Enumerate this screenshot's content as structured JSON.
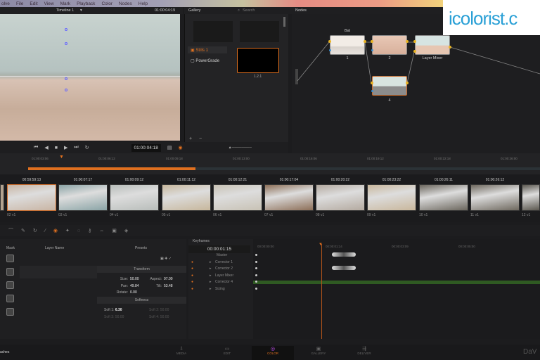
{
  "menu": [
    "olve",
    "File",
    "Edit",
    "View",
    "Mark",
    "Playback",
    "Color",
    "Nodes",
    "Help"
  ],
  "viewer": {
    "timeline_name": "Timeline 1",
    "timecode": "01:00:04:19",
    "transport_timecode": "01:00:04:18"
  },
  "gallery": {
    "title": "Gallery",
    "search_placeholder": "Search",
    "albums": [
      "Stills 1",
      "PowerGrade"
    ],
    "still_label": "1.2.1"
  },
  "nodes": {
    "title": "Nodes",
    "items": [
      {
        "label": "1",
        "top": "Bal"
      },
      {
        "label": "2"
      },
      {
        "label": "Layer Mixer"
      },
      {
        "label": "4"
      }
    ]
  },
  "logo": "icolorist.c",
  "ruler": [
    "01:00:03:06",
    "01:00:06:12",
    "01:00:09:18",
    "01:00:13:00",
    "01:00:16:06",
    "01:00:19:12",
    "01:00:22:18",
    "01:00:26:00"
  ],
  "clips": [
    {
      "tc": "00:59:59:13",
      "label": "02  v1",
      "color": "#c9b5a4"
    },
    {
      "tc": "01:00:07:17",
      "label": "03  v1",
      "color": "#8aa4a6"
    },
    {
      "tc": "01:00:09:12",
      "label": "04  v1",
      "color": "#b8bdba"
    },
    {
      "tc": "01:00:11:12",
      "label": "05  v1",
      "color": "#c7b79c"
    },
    {
      "tc": "01:00:12:21",
      "label": "06  v1",
      "color": "#c8c2b5"
    },
    {
      "tc": "01:00:17:04",
      "label": "07  v1",
      "color": "#8d6f58"
    },
    {
      "tc": "01:00:20:22",
      "label": "08  v1",
      "color": "#b4aaa0"
    },
    {
      "tc": "01:00:23:22",
      "label": "09  v1",
      "color": "#c9b79c"
    },
    {
      "tc": "01:00:26:11",
      "label": "10  v1",
      "color": "#6b665d"
    },
    {
      "tc": "01:00:26:12",
      "label": "11  v1",
      "color": "#6e685e"
    },
    {
      "tc": "",
      "label": "12  v1",
      "color": "#5c5850"
    }
  ],
  "window_panel": {
    "headers": {
      "mask": "Mask",
      "layer_name": "Layer Name",
      "presets": "Presets"
    },
    "transform_title": "Transform",
    "softness_title": "Softness",
    "fields": {
      "size": "Size:",
      "size_val": "50.00",
      "aspect": "Aspect:",
      "aspect_val": "97.00",
      "pan": "Pan:",
      "pan_val": "49.84",
      "tilt": "Tilt:",
      "tilt_val": "53.48",
      "rotate": "Rotate:",
      "rotate_val": "0.00",
      "soft1": "Soft 1:",
      "soft1_val": "6.30",
      "soft2": "Soft 2:",
      "soft2_val": "50.00",
      "soft3": "Soft 3:",
      "soft3_val": "50.00",
      "soft4": "Soft 4:",
      "soft4_val": "50.00"
    }
  },
  "keyframes": {
    "title": "Keyframes",
    "timecode": "00:00:01:15",
    "tracks": [
      "Master",
      "Corrector 1",
      "Corrector 2",
      "Layer Mixer",
      "Corrector 4",
      "Sizing"
    ],
    "ruler": [
      "00:00:00:00",
      "00:00:01:14",
      "00:00:03:09",
      "00:00:05:00"
    ]
  },
  "pages": [
    "MEDIA",
    "EDIT",
    "COLOR",
    "GALLERY",
    "DELIVER"
  ],
  "active_page": "COLOR",
  "brand": "DaV",
  "project": "aches",
  "colors": {
    "accent": "#e0701f",
    "node_dot": "#e8b323"
  }
}
